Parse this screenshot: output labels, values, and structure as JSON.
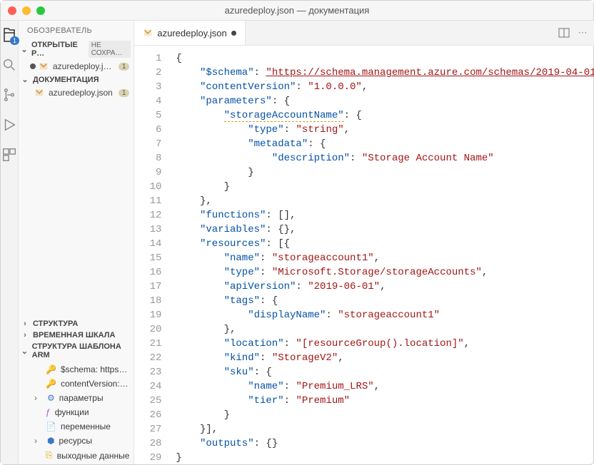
{
  "window": {
    "title": "azuredeploy.json — документация"
  },
  "activity": {
    "badge": "1"
  },
  "sidebar": {
    "title": "ОБОЗРЕВАТЕЛЬ",
    "openEditors": {
      "label": "ОТКРЫТЫЕ Р…",
      "unsaved": "НЕ СОХРА…"
    },
    "openFile": {
      "name": "azuredeploy.j…",
      "count": "1"
    },
    "folder": {
      "label": "ДОКУМЕНТАЦИЯ"
    },
    "folderFile": {
      "name": "azuredeploy.json",
      "count": "1"
    },
    "structure": "СТРУКТУРА",
    "timeline": "ВРЕМЕННАЯ ШКАЛА",
    "arm": "СТРУКТУРА ШАБЛОНА ARM",
    "armItems": {
      "schema": "$schema: https…",
      "contentVersion": "contentVersion:…",
      "parameters": "параметры",
      "functions": "функции",
      "variables": "переменные",
      "resources": "ресурсы",
      "outputs": "выходные данные"
    }
  },
  "tab": {
    "name": "azuredeploy.json"
  },
  "code": {
    "lines": [
      {
        "n": "1",
        "tokens": [
          {
            "c": "t-punc",
            "t": "{"
          }
        ]
      },
      {
        "n": "2",
        "tokens": [
          {
            "c": "t-plain",
            "t": "    "
          },
          {
            "c": "t-key",
            "t": "\"$schema\""
          },
          {
            "c": "t-punc",
            "t": ": "
          },
          {
            "c": "t-url",
            "t": "\"https://schema.management.azure.com/schemas/2019-04-01"
          }
        ]
      },
      {
        "n": "3",
        "tokens": [
          {
            "c": "t-plain",
            "t": "    "
          },
          {
            "c": "t-key",
            "t": "\"contentVersion\""
          },
          {
            "c": "t-punc",
            "t": ": "
          },
          {
            "c": "t-str",
            "t": "\"1.0.0.0\""
          },
          {
            "c": "t-punc",
            "t": ","
          }
        ]
      },
      {
        "n": "4",
        "tokens": [
          {
            "c": "t-plain",
            "t": "    "
          },
          {
            "c": "t-key",
            "t": "\"parameters\""
          },
          {
            "c": "t-punc",
            "t": ": {"
          }
        ]
      },
      {
        "n": "5",
        "tokens": [
          {
            "c": "t-plain",
            "t": "        "
          },
          {
            "c": "t-key t-warn",
            "t": "\"storageAccountName\""
          },
          {
            "c": "t-punc",
            "t": ": {"
          }
        ]
      },
      {
        "n": "6",
        "tokens": [
          {
            "c": "t-plain",
            "t": "            "
          },
          {
            "c": "t-key",
            "t": "\"type\""
          },
          {
            "c": "t-punc",
            "t": ": "
          },
          {
            "c": "t-str",
            "t": "\"string\""
          },
          {
            "c": "t-punc",
            "t": ","
          }
        ]
      },
      {
        "n": "7",
        "tokens": [
          {
            "c": "t-plain",
            "t": "            "
          },
          {
            "c": "t-key",
            "t": "\"metadata\""
          },
          {
            "c": "t-punc",
            "t": ": {"
          }
        ]
      },
      {
        "n": "8",
        "tokens": [
          {
            "c": "t-plain",
            "t": "                "
          },
          {
            "c": "t-key",
            "t": "\"description\""
          },
          {
            "c": "t-punc",
            "t": ": "
          },
          {
            "c": "t-str",
            "t": "\"Storage Account Name\""
          }
        ]
      },
      {
        "n": "9",
        "tokens": [
          {
            "c": "t-plain",
            "t": "            "
          },
          {
            "c": "t-punc",
            "t": "}"
          }
        ]
      },
      {
        "n": "10",
        "tokens": [
          {
            "c": "t-plain",
            "t": "        "
          },
          {
            "c": "t-punc",
            "t": "}"
          }
        ]
      },
      {
        "n": "11",
        "tokens": [
          {
            "c": "t-plain",
            "t": "    "
          },
          {
            "c": "t-punc",
            "t": "},"
          }
        ]
      },
      {
        "n": "12",
        "tokens": [
          {
            "c": "t-plain",
            "t": "    "
          },
          {
            "c": "t-key",
            "t": "\"functions\""
          },
          {
            "c": "t-punc",
            "t": ": [],"
          }
        ]
      },
      {
        "n": "13",
        "tokens": [
          {
            "c": "t-plain",
            "t": "    "
          },
          {
            "c": "t-key",
            "t": "\"variables\""
          },
          {
            "c": "t-punc",
            "t": ": {},"
          }
        ]
      },
      {
        "n": "14",
        "tokens": [
          {
            "c": "t-plain",
            "t": "    "
          },
          {
            "c": "t-key",
            "t": "\"resources\""
          },
          {
            "c": "t-punc",
            "t": ": [{"
          }
        ]
      },
      {
        "n": "15",
        "tokens": [
          {
            "c": "t-plain",
            "t": "        "
          },
          {
            "c": "t-key",
            "t": "\"name\""
          },
          {
            "c": "t-punc",
            "t": ": "
          },
          {
            "c": "t-str",
            "t": "\"storageaccount1\""
          },
          {
            "c": "t-punc",
            "t": ","
          }
        ]
      },
      {
        "n": "16",
        "tokens": [
          {
            "c": "t-plain",
            "t": "        "
          },
          {
            "c": "t-key",
            "t": "\"type\""
          },
          {
            "c": "t-punc",
            "t": ": "
          },
          {
            "c": "t-str",
            "t": "\"Microsoft.Storage/storageAccounts\""
          },
          {
            "c": "t-punc",
            "t": ","
          }
        ]
      },
      {
        "n": "17",
        "tokens": [
          {
            "c": "t-plain",
            "t": "        "
          },
          {
            "c": "t-key",
            "t": "\"apiVersion\""
          },
          {
            "c": "t-punc",
            "t": ": "
          },
          {
            "c": "t-str",
            "t": "\"2019-06-01\""
          },
          {
            "c": "t-punc",
            "t": ","
          }
        ]
      },
      {
        "n": "18",
        "tokens": [
          {
            "c": "t-plain",
            "t": "        "
          },
          {
            "c": "t-key",
            "t": "\"tags\""
          },
          {
            "c": "t-punc",
            "t": ": {"
          }
        ]
      },
      {
        "n": "19",
        "tokens": [
          {
            "c": "t-plain",
            "t": "            "
          },
          {
            "c": "t-key",
            "t": "\"displayName\""
          },
          {
            "c": "t-punc",
            "t": ": "
          },
          {
            "c": "t-str",
            "t": "\"storageaccount1\""
          }
        ]
      },
      {
        "n": "20",
        "tokens": [
          {
            "c": "t-plain",
            "t": "        "
          },
          {
            "c": "t-punc",
            "t": "},"
          }
        ]
      },
      {
        "n": "21",
        "tokens": [
          {
            "c": "t-plain",
            "t": "        "
          },
          {
            "c": "t-key",
            "t": "\"location\""
          },
          {
            "c": "t-punc",
            "t": ": "
          },
          {
            "c": "t-str",
            "t": "\"[resourceGroup().location]\""
          },
          {
            "c": "t-punc",
            "t": ","
          }
        ]
      },
      {
        "n": "22",
        "tokens": [
          {
            "c": "t-plain",
            "t": "        "
          },
          {
            "c": "t-key",
            "t": "\"kind\""
          },
          {
            "c": "t-punc",
            "t": ": "
          },
          {
            "c": "t-str",
            "t": "\"StorageV2\""
          },
          {
            "c": "t-punc",
            "t": ","
          }
        ]
      },
      {
        "n": "23",
        "tokens": [
          {
            "c": "t-plain",
            "t": "        "
          },
          {
            "c": "t-key",
            "t": "\"sku\""
          },
          {
            "c": "t-punc",
            "t": ": {"
          }
        ]
      },
      {
        "n": "24",
        "tokens": [
          {
            "c": "t-plain",
            "t": "            "
          },
          {
            "c": "t-key",
            "t": "\"name\""
          },
          {
            "c": "t-punc",
            "t": ": "
          },
          {
            "c": "t-str",
            "t": "\"Premium_LRS\""
          },
          {
            "c": "t-punc",
            "t": ","
          }
        ]
      },
      {
        "n": "25",
        "tokens": [
          {
            "c": "t-plain",
            "t": "            "
          },
          {
            "c": "t-key",
            "t": "\"tier\""
          },
          {
            "c": "t-punc",
            "t": ": "
          },
          {
            "c": "t-str",
            "t": "\"Premium\""
          }
        ]
      },
      {
        "n": "26",
        "tokens": [
          {
            "c": "t-plain",
            "t": "        "
          },
          {
            "c": "t-punc",
            "t": "}"
          }
        ]
      },
      {
        "n": "27",
        "tokens": [
          {
            "c": "t-plain",
            "t": "    "
          },
          {
            "c": "t-punc",
            "t": "}],"
          }
        ]
      },
      {
        "n": "28",
        "tokens": [
          {
            "c": "t-plain",
            "t": "    "
          },
          {
            "c": "t-key",
            "t": "\"outputs\""
          },
          {
            "c": "t-punc",
            "t": ": {}"
          }
        ]
      },
      {
        "n": "29",
        "tokens": [
          {
            "c": "t-punc",
            "t": "}"
          }
        ]
      }
    ]
  }
}
